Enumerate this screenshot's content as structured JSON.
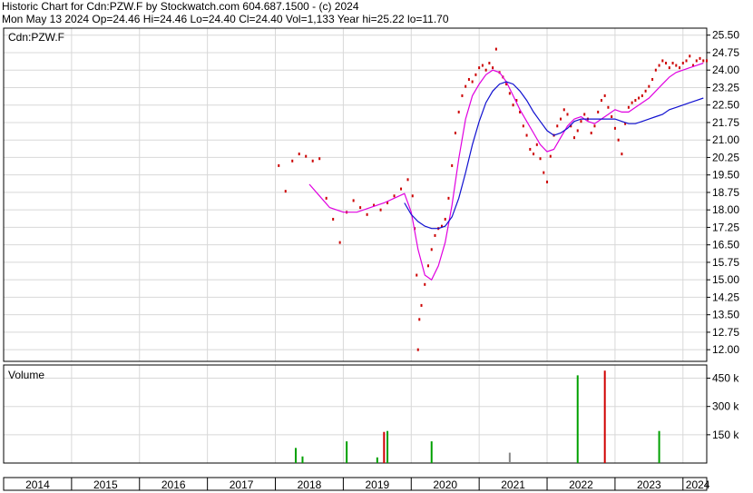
{
  "header": {
    "line1": "Historic Chart for Cdn:PZW.F by Stockwatch.com 604.687.1500 - (c) 2024",
    "line2": "Mon May 13 2024   Op=24.46   Hi=24.46   Lo=24.40   Cl=24.40   Vol=1,133   Year hi=25.22   lo=11.70"
  },
  "price_panel": {
    "symbol_label": "Cdn:PZW.F"
  },
  "volume_panel": {
    "label": "Volume"
  },
  "colors": {
    "price": "#cc0000",
    "ma_fast": "#e000e0",
    "ma_slow": "#1010d0",
    "vol_up": "#00a000",
    "vol_down": "#d00000",
    "vol_neutral": "#888888",
    "grid": "#d8d8d8",
    "axis": "#000000"
  },
  "chart_data": {
    "type": "line",
    "x_axis": {
      "labels": [
        "2014",
        "2015",
        "2016",
        "2017",
        "2018",
        "2019",
        "2020",
        "2021",
        "2022",
        "2023",
        "2024"
      ]
    },
    "price_axis": {
      "ylim": [
        11.5,
        25.8
      ],
      "ticks": [
        "25.50",
        "24.75",
        "24.00",
        "23.25",
        "22.50",
        "21.75",
        "21.00",
        "20.25",
        "19.50",
        "18.75",
        "18.00",
        "17.25",
        "16.50",
        "15.75",
        "15.00",
        "14.25",
        "13.50",
        "12.75",
        "12.00"
      ]
    },
    "volume_axis": {
      "ylim": [
        0,
        520000
      ],
      "ticks": [
        "450 k",
        "300 k",
        "150 k"
      ]
    },
    "price_series": {
      "x": [
        2018.05,
        2018.15,
        2018.25,
        2018.35,
        2018.45,
        2018.55,
        2018.65,
        2018.75,
        2018.85,
        2018.95,
        2019.05,
        2019.15,
        2019.25,
        2019.35,
        2019.45,
        2019.55,
        2019.65,
        2019.75,
        2019.85,
        2019.95,
        2020.02,
        2020.05,
        2020.08,
        2020.1,
        2020.12,
        2020.15,
        2020.2,
        2020.25,
        2020.3,
        2020.35,
        2020.4,
        2020.45,
        2020.5,
        2020.55,
        2020.6,
        2020.65,
        2020.7,
        2020.75,
        2020.8,
        2020.85,
        2020.9,
        2020.95,
        2021.0,
        2021.05,
        2021.1,
        2021.15,
        2021.2,
        2021.25,
        2021.3,
        2021.35,
        2021.4,
        2021.45,
        2021.5,
        2021.55,
        2021.6,
        2021.65,
        2021.7,
        2021.75,
        2021.8,
        2021.85,
        2021.9,
        2021.95,
        2022.0,
        2022.05,
        2022.1,
        2022.15,
        2022.2,
        2022.25,
        2022.3,
        2022.35,
        2022.4,
        2022.45,
        2022.5,
        2022.55,
        2022.6,
        2022.65,
        2022.7,
        2022.75,
        2022.8,
        2022.85,
        2022.9,
        2022.95,
        2023.0,
        2023.05,
        2023.1,
        2023.15,
        2023.2,
        2023.25,
        2023.3,
        2023.35,
        2023.4,
        2023.45,
        2023.5,
        2023.55,
        2023.6,
        2023.65,
        2023.7,
        2023.75,
        2023.8,
        2023.85,
        2023.9,
        2023.95,
        2024.0,
        2024.05,
        2024.1,
        2024.15,
        2024.2,
        2024.25,
        2024.3,
        2024.35
      ],
      "values": [
        19.9,
        18.8,
        20.1,
        20.4,
        20.3,
        20.1,
        20.2,
        18.5,
        17.6,
        16.6,
        17.9,
        18.4,
        18.1,
        17.8,
        18.2,
        18.0,
        18.3,
        18.6,
        18.9,
        19.3,
        18.6,
        17.2,
        15.2,
        12.0,
        13.3,
        13.9,
        14.8,
        15.6,
        16.3,
        16.9,
        17.2,
        17.3,
        17.6,
        18.5,
        19.9,
        21.3,
        22.2,
        22.9,
        23.3,
        23.6,
        23.5,
        23.8,
        24.1,
        24.2,
        24.0,
        24.3,
        24.1,
        24.9,
        23.9,
        23.7,
        23.4,
        23.0,
        22.5,
        22.7,
        22.2,
        21.6,
        21.2,
        20.6,
        20.4,
        20.8,
        20.2,
        19.6,
        19.2,
        20.3,
        21.2,
        21.6,
        21.9,
        22.3,
        22.1,
        21.6,
        21.1,
        21.4,
        21.8,
        22.1,
        21.9,
        21.3,
        21.6,
        22.2,
        22.7,
        22.9,
        22.4,
        22.0,
        21.5,
        21.0,
        20.4,
        21.7,
        22.4,
        22.6,
        22.7,
        22.8,
        22.9,
        23.1,
        23.3,
        23.6,
        24.0,
        24.2,
        24.4,
        24.3,
        24.1,
        24.3,
        24.2,
        24.1,
        24.3,
        24.4,
        24.6,
        24.2,
        24.4,
        24.5,
        24.4,
        24.4
      ]
    },
    "ma_fast": {
      "x": [
        2018.5,
        2018.65,
        2018.8,
        2019.0,
        2019.2,
        2019.4,
        2019.6,
        2019.75,
        2019.9,
        2020.0,
        2020.1,
        2020.2,
        2020.3,
        2020.4,
        2020.5,
        2020.6,
        2020.7,
        2020.8,
        2020.9,
        2021.0,
        2021.1,
        2021.2,
        2021.3,
        2021.4,
        2021.5,
        2021.6,
        2021.7,
        2021.8,
        2021.9,
        2022.0,
        2022.1,
        2022.2,
        2022.3,
        2022.4,
        2022.5,
        2022.6,
        2022.7,
        2022.8,
        2022.9,
        2023.0,
        2023.1,
        2023.2,
        2023.3,
        2023.4,
        2023.5,
        2023.6,
        2023.7,
        2023.8,
        2023.9,
        2024.0,
        2024.1,
        2024.2,
        2024.3
      ],
      "values": [
        19.1,
        18.6,
        18.1,
        17.9,
        17.9,
        18.1,
        18.3,
        18.5,
        18.7,
        17.9,
        16.3,
        15.2,
        15.0,
        15.6,
        16.6,
        18.2,
        20.2,
        21.9,
        22.9,
        23.4,
        23.8,
        24.0,
        23.9,
        23.5,
        22.9,
        22.3,
        21.8,
        21.3,
        20.8,
        20.5,
        20.6,
        21.1,
        21.6,
        21.9,
        22.0,
        21.8,
        21.7,
        21.9,
        22.1,
        22.3,
        22.2,
        22.2,
        22.4,
        22.6,
        22.8,
        23.1,
        23.4,
        23.7,
        23.9,
        24.0,
        24.1,
        24.2,
        24.3
      ]
    },
    "ma_slow": {
      "x": [
        2019.9,
        2020.0,
        2020.1,
        2020.2,
        2020.3,
        2020.4,
        2020.5,
        2020.6,
        2020.7,
        2020.8,
        2020.9,
        2021.0,
        2021.1,
        2021.2,
        2021.3,
        2021.4,
        2021.5,
        2021.6,
        2021.7,
        2021.8,
        2021.9,
        2022.0,
        2022.1,
        2022.2,
        2022.3,
        2022.4,
        2022.5,
        2022.6,
        2022.7,
        2022.8,
        2022.9,
        2023.0,
        2023.1,
        2023.2,
        2023.3,
        2023.4,
        2023.5,
        2023.6,
        2023.7,
        2023.8,
        2023.9,
        2024.0,
        2024.1,
        2024.2,
        2024.3
      ],
      "values": [
        18.3,
        17.8,
        17.5,
        17.3,
        17.2,
        17.2,
        17.3,
        17.7,
        18.5,
        19.6,
        20.8,
        21.8,
        22.6,
        23.1,
        23.4,
        23.5,
        23.4,
        23.1,
        22.7,
        22.2,
        21.8,
        21.4,
        21.2,
        21.3,
        21.5,
        21.8,
        21.9,
        21.9,
        21.9,
        21.9,
        21.9,
        21.9,
        21.8,
        21.7,
        21.7,
        21.8,
        21.9,
        22.0,
        22.1,
        22.3,
        22.4,
        22.5,
        22.6,
        22.7,
        22.8
      ]
    },
    "volume_series": {
      "x": [
        2018.3,
        2018.4,
        2019.05,
        2019.5,
        2019.6,
        2019.65,
        2020.3,
        2021.45,
        2022.45,
        2022.85,
        2023.65
      ],
      "values": [
        80000,
        35000,
        115000,
        30000,
        165000,
        170000,
        115000,
        55000,
        465000,
        490000,
        170000
      ],
      "direction": [
        "up",
        "up",
        "up",
        "up",
        "down",
        "up",
        "up",
        "neutral",
        "up",
        "down",
        "up"
      ]
    }
  }
}
